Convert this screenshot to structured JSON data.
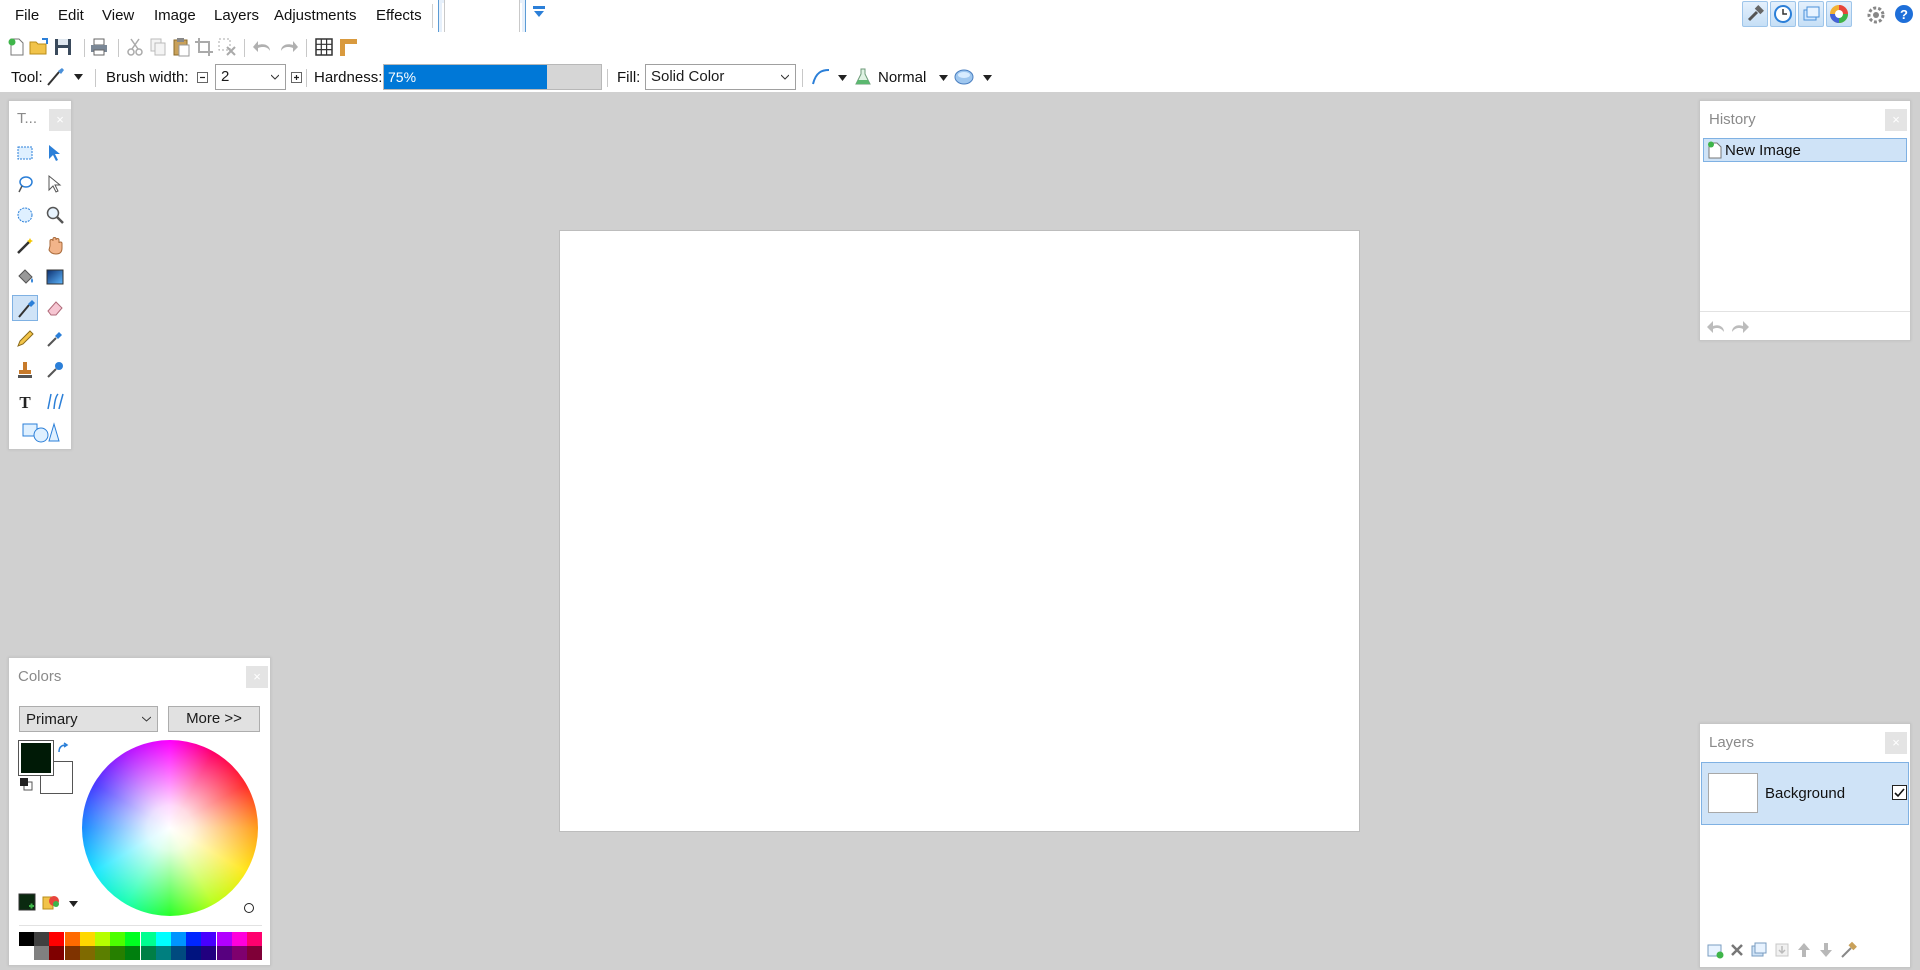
{
  "menu": {
    "items": [
      "File",
      "Edit",
      "View",
      "Image",
      "Layers",
      "Adjustments",
      "Effects"
    ]
  },
  "toolbar": {
    "tool_label": "Tool:",
    "brush_width_label": "Brush width:",
    "brush_width_value": "2",
    "hardness_label": "Hardness:",
    "hardness_value": "75%",
    "hardness_fraction": 0.75,
    "fill_label": "Fill:",
    "fill_value": "Solid Color",
    "blend_mode": "Normal"
  },
  "tools_panel": {
    "title": "T...",
    "tools": [
      "rectangle-select",
      "move-selected",
      "lasso-select",
      "move-selection",
      "ellipse-select",
      "zoom",
      "magic-wand",
      "pan",
      "paint-bucket",
      "gradient",
      "paintbrush",
      "eraser",
      "pencil",
      "color-picker",
      "clone-stamp",
      "recolor",
      "text",
      "line-curve",
      "shapes"
    ],
    "active_tool": "paintbrush"
  },
  "history": {
    "title": "History",
    "items": [
      "New Image"
    ]
  },
  "layers": {
    "title": "Layers",
    "items": [
      {
        "name": "Background",
        "visible": true
      }
    ]
  },
  "colors": {
    "title": "Colors",
    "selector": "Primary",
    "more_button": "More >>",
    "primary": "#001a06",
    "secondary": "#ffffff",
    "palette_row1": [
      "#000000",
      "#404040",
      "#ff0000",
      "#ff6a00",
      "#ffd800",
      "#b6ff00",
      "#4cff00",
      "#00ff21",
      "#00ff90",
      "#00ffff",
      "#0094ff",
      "#0026ff",
      "#4800ff",
      "#b200ff",
      "#ff00dc",
      "#ff006e"
    ],
    "palette_row2": [
      "#ffffff",
      "#808080",
      "#7f0000",
      "#7f3300",
      "#7f6a00",
      "#5b7f00",
      "#267f00",
      "#007f0e",
      "#007f46",
      "#007f7f",
      "#004a7f",
      "#00137f",
      "#21007f",
      "#57007f",
      "#7f006e",
      "#7f0037"
    ]
  },
  "accent_color": "#0078d7"
}
